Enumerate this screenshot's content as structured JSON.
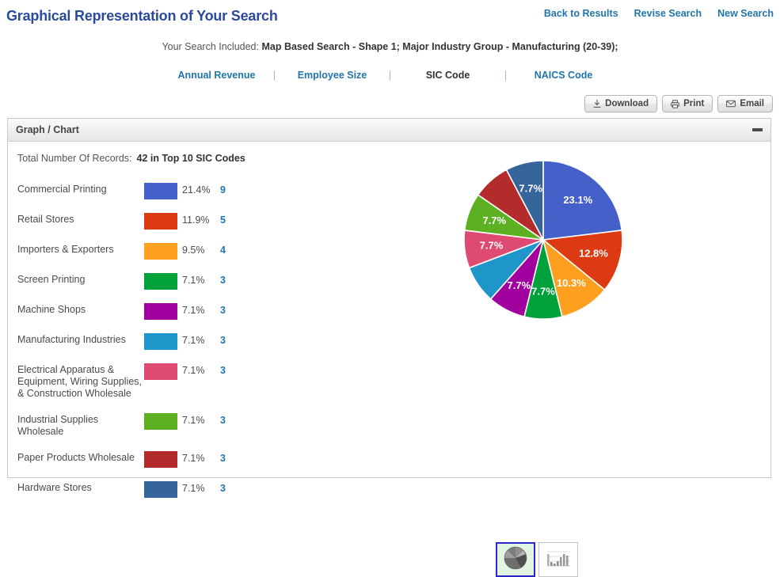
{
  "header": {
    "title": "Graphical Representation of Your Search",
    "links": [
      {
        "label": "Back to Results",
        "name": "back-to-results-link"
      },
      {
        "label": "Revise Search",
        "name": "revise-search-link"
      },
      {
        "label": "New Search",
        "name": "new-search-link"
      }
    ]
  },
  "search_summary": {
    "prefix": "Your Search Included:",
    "criteria": "Map Based Search - Shape 1; Major Industry Group - Manufacturing (20-39);"
  },
  "criteria_nav": {
    "separator": "|",
    "items": [
      {
        "label": "Annual Revenue",
        "active": false
      },
      {
        "label": "Employee Size",
        "active": false
      },
      {
        "label": "SIC Code",
        "active": true
      },
      {
        "label": "NAICS Code",
        "active": false
      }
    ]
  },
  "actions": [
    {
      "label": "Download",
      "icon": "download-icon"
    },
    {
      "label": "Print",
      "icon": "printer-icon"
    },
    {
      "label": "Email",
      "icon": "envelope-icon"
    }
  ],
  "panel": {
    "title": "Graph / Chart",
    "minimize_icon": "minimize-icon",
    "total_label": "Total Number Of Records:",
    "total_value": "42 in Top 10 SIC Codes"
  },
  "chart_switch": {
    "options": [
      {
        "name": "pie-chart-option",
        "icon": "pie-chart-icon",
        "selected": true
      },
      {
        "name": "bar-chart-option",
        "icon": "bar-chart-icon",
        "selected": false
      }
    ]
  },
  "legend": {
    "rows": [
      {
        "label": "Commercial Printing",
        "color": "#4560c8",
        "percent": "21.4%",
        "count": "9"
      },
      {
        "label": "Retail Stores",
        "color": "#dc3a13",
        "percent": "11.9%",
        "count": "5"
      },
      {
        "label": "Importers & Exporters",
        "color": "#fda01f",
        "percent": "9.5%",
        "count": "4"
      },
      {
        "label": "Screen Printing",
        "color": "#00a03a",
        "percent": "7.1%",
        "count": "3"
      },
      {
        "label": "Machine Shops",
        "color": "#a0019f",
        "percent": "7.1%",
        "count": "3"
      },
      {
        "label": "Manufacturing Industries",
        "color": "#1f96c9",
        "percent": "7.1%",
        "count": "3"
      },
      {
        "label": "Electrical Apparatus & Equipment, Wiring Supplies, & Construction Wholesale",
        "color": "#df4a72",
        "percent": "7.1%",
        "count": "3"
      },
      {
        "label": "Industrial Supplies Wholesale",
        "color": "#5cb022",
        "percent": "7.1%",
        "count": "3"
      },
      {
        "label": "Paper Products Wholesale",
        "color": "#b32b2b",
        "percent": "7.1%",
        "count": "3"
      },
      {
        "label": "Hardware Stores",
        "color": "#36659b",
        "percent": "7.1%",
        "count": "3"
      }
    ]
  },
  "chart_data": {
    "type": "pie",
    "title": "",
    "legend_position": "left",
    "start_angle_deg": 0,
    "direction": "clockwise",
    "categories": [
      "Commercial Printing",
      "Retail Stores",
      "Importers & Exporters",
      "Screen Printing",
      "Machine Shops",
      "Manufacturing Industries",
      "Electrical Apparatus & Equipment, Wiring Supplies, & Construction Wholesale",
      "Industrial Supplies Wholesale",
      "Paper Products Wholesale",
      "Hardware Stores"
    ],
    "values": [
      23.1,
      12.8,
      10.3,
      7.7,
      7.7,
      7.7,
      7.7,
      7.7,
      7.7,
      7.7
    ],
    "slice_labels": [
      "23.1%",
      "12.8%",
      "10.3%",
      "7.7%",
      "7.7%",
      "",
      "7.7%",
      "7.7%",
      "",
      "7.7%"
    ],
    "colors": [
      "#4560c8",
      "#dc3a13",
      "#fda01f",
      "#00a03a",
      "#a0019f",
      "#1f96c9",
      "#df4a72",
      "#5cb022",
      "#b32b2b",
      "#36659b"
    ],
    "counts": [
      9,
      5,
      4,
      3,
      3,
      3,
      3,
      3,
      3,
      3
    ],
    "record_total": 42
  }
}
